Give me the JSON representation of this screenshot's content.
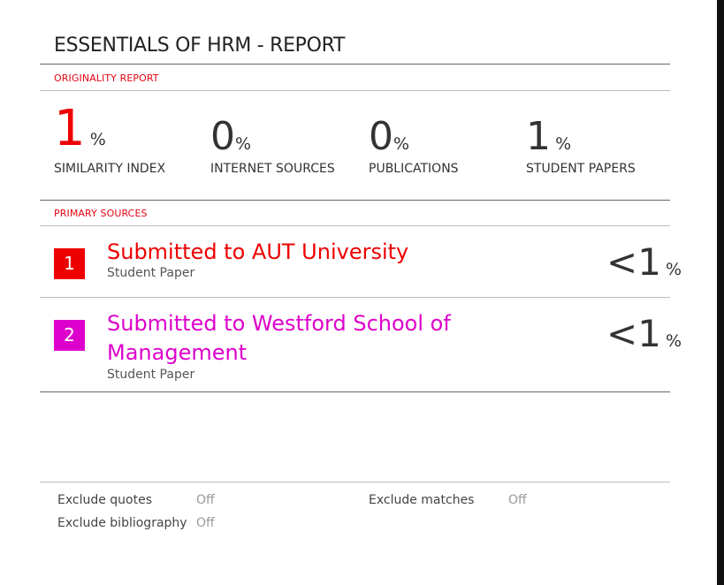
{
  "report": {
    "title": "ESSENTIALS OF HRM - REPORT",
    "originality_label": "ORIGINALITY REPORT",
    "primary_sources_label": "PRIMARY SOURCES"
  },
  "stats": [
    {
      "value": "1",
      "unit": "%",
      "label": "SIMILARITY INDEX",
      "color": "#ee0000"
    },
    {
      "value": "0",
      "unit": "%",
      "label": "INTERNET SOURCES"
    },
    {
      "value": "0",
      "unit": "%",
      "label": "PUBLICATIONS"
    },
    {
      "value": "1",
      "unit": "%",
      "label": "STUDENT PAPERS"
    }
  ],
  "sources": [
    {
      "rank": "1",
      "title": "Submitted to AUT University",
      "type": "Student Paper",
      "match": "<1",
      "unit": "%",
      "color": "#ee0000"
    },
    {
      "rank": "2",
      "title": "Submitted to Westford School of Management",
      "type": "Student Paper",
      "match": "<1",
      "unit": "%",
      "color": "#dd00cc"
    }
  ],
  "footer": {
    "exclude_quotes_label": "Exclude quotes",
    "exclude_quotes_value": "Off",
    "exclude_matches_label": "Exclude matches",
    "exclude_matches_value": "Off",
    "exclude_bibliography_label": "Exclude bibliography",
    "exclude_bibliography_value": "Off"
  }
}
